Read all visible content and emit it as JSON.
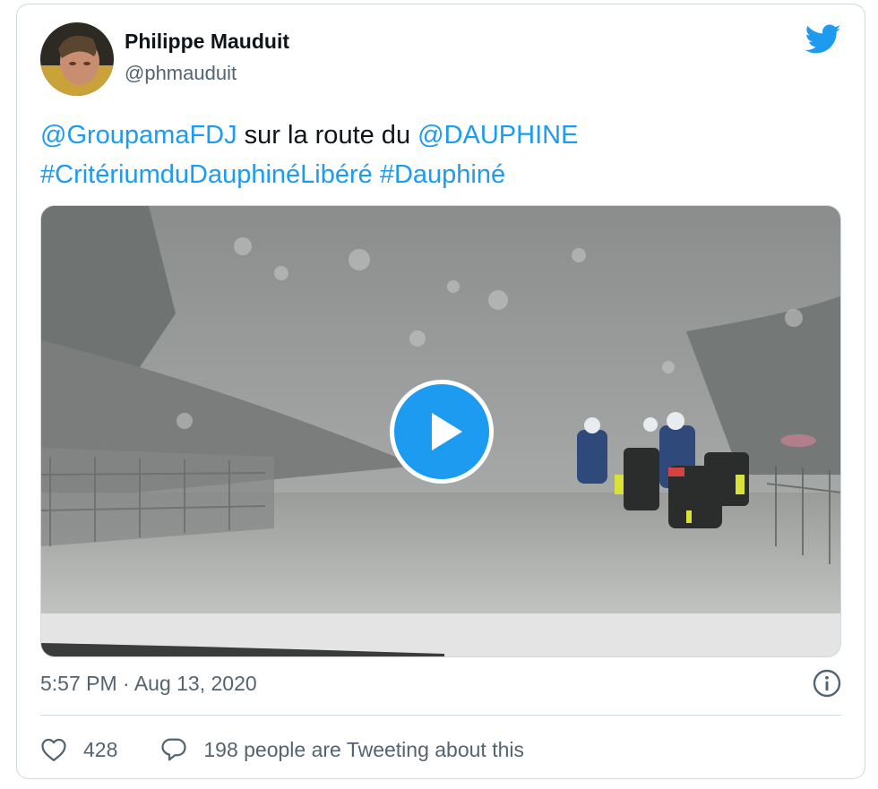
{
  "author": {
    "name": "Philippe Mauduit",
    "handle": "@phmauduit"
  },
  "tweet": {
    "mention1": "@GroupamaFDJ",
    "text1": " sur la route du ",
    "mention2": "@DAUPHINE",
    "hashtag1": "#CritériumduDauphinéLibéré",
    "hashtag2": "#Dauphiné",
    "timestamp": "5:57 PM · Aug 13, 2020"
  },
  "stats": {
    "likes": "428",
    "tweeting": "198 people are Tweeting about this"
  },
  "icons": {
    "logo": "twitter-bird-icon",
    "play": "play-icon",
    "info": "info-icon",
    "like": "heart-icon",
    "reply": "speech-bubble-icon"
  },
  "colors": {
    "accent": "#1d9bf0",
    "text": "#0f1419",
    "secondary": "#536471",
    "border": "#cfd9de"
  }
}
